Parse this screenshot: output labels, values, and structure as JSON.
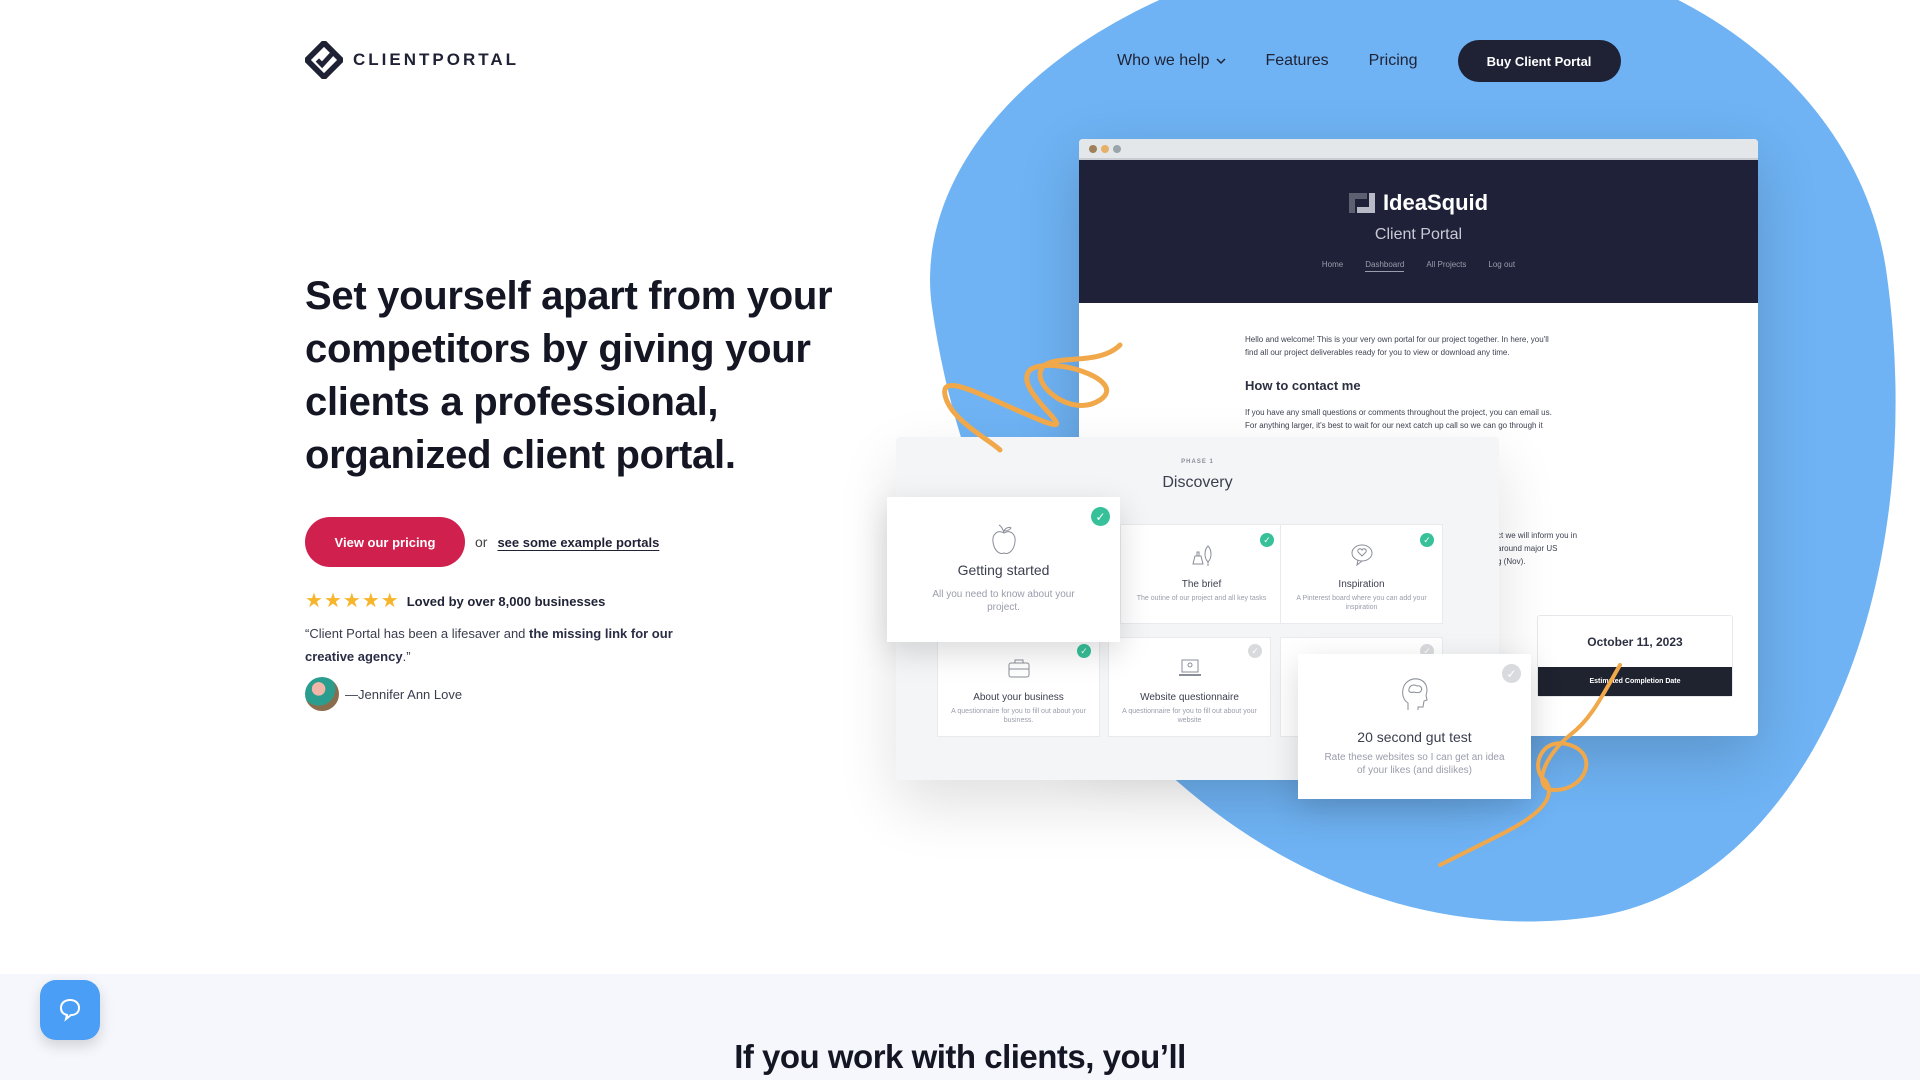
{
  "brand": {
    "name": "CLIENTPORTAL"
  },
  "nav": {
    "items": [
      {
        "label": "Who we help",
        "has_dropdown": true
      },
      {
        "label": "Features"
      },
      {
        "label": "Pricing"
      }
    ],
    "cta_label": "Buy Client Portal"
  },
  "hero": {
    "headline": "Set yourself apart from your competitors by giving your clients a professional, organized client portal.",
    "primary_cta": "View our pricing",
    "or_text": "or",
    "secondary_link": "see some example portals",
    "rating": {
      "stars": 5,
      "max_stars": 5,
      "text": "Loved by over 8,000 businesses"
    },
    "quote": {
      "open": "“Client Portal has been a lifesaver and ",
      "bold1": "the missing link for our creative agency",
      "close": ".”"
    },
    "author": "—Jennifer Ann Love"
  },
  "mockup": {
    "window_dots": [
      "#a0805a",
      "#e7b068",
      "#9aa6ab"
    ],
    "portal_brand": "IdeaSquid",
    "portal_subtitle": "Client Portal",
    "portal_nav": [
      "Home",
      "Dashboard",
      "All Projects",
      "Log out"
    ],
    "portal_nav_active": "Dashboard",
    "welcome_line1": "Hello and welcome! This is your very own portal for our project together. In here, you'll",
    "welcome_line2": "find all our project deliverables ready for you to view or download any time.",
    "contact_heading": "How to contact me",
    "contact_line1": "If you have any small questions or comments throughout the project, you can email us.",
    "contact_line2": "For anything larger, it's best to wait for our next catch up call so we can go through it",
    "side_line1": "ct we will inform you in",
    "side_line2": "around major US",
    "side_line3": "g (Nov).",
    "completion_date": "October 11, 2023",
    "completion_label": "Estimated Completion Date",
    "phase_label": "PHASE 1",
    "phase_title": "Discovery",
    "tasks": [
      {
        "title": "Getting started",
        "desc": "All you need to know about your project.",
        "done": true,
        "icon": "apple-icon"
      },
      {
        "title": "The brief",
        "desc": "The outine of our project and all key tasks",
        "done": true,
        "icon": "brief-icon"
      },
      {
        "title": "Inspiration",
        "desc": "A Pinterest board where you can add your inspiration",
        "done": true,
        "icon": "heart-bubble-icon"
      },
      {
        "title": "About your business",
        "desc": "A questionnaire for you to fill out about your business.",
        "done": true,
        "icon": "briefcase-icon"
      },
      {
        "title": "Website questionnaire",
        "desc": "A questionnaire for you to fill out about your website",
        "done": false,
        "icon": "laptop-icon"
      },
      {
        "title": "20 second gut test",
        "desc": "Rate these websites so I can get an idea of your likes (and dislikes)",
        "done": false,
        "icon": "brain-head-icon"
      }
    ]
  },
  "next_section": {
    "title": "If you work with clients, you’ll"
  },
  "colors": {
    "accent_red": "#d0204e",
    "navy": "#1f2235",
    "blob_blue": "#6fb3f4",
    "check_green": "#37c19a",
    "chat_blue": "#4a9ef5"
  }
}
